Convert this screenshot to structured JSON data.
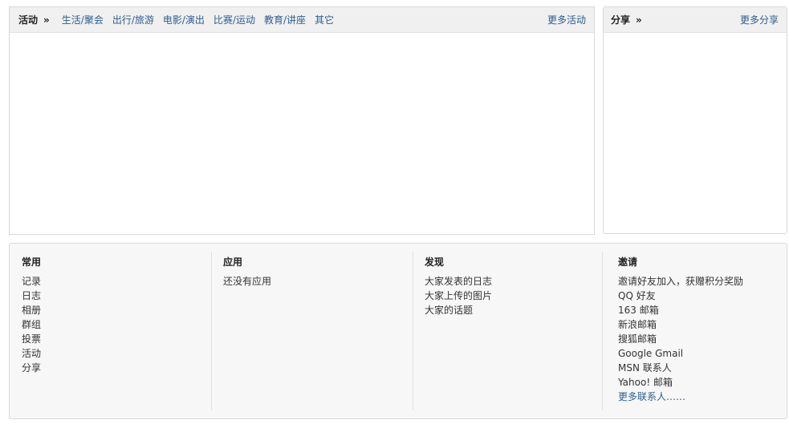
{
  "activity": {
    "title": "活动",
    "arrow": "»",
    "categories": [
      "生活/聚会",
      "出行/旅游",
      "电影/演出",
      "比赛/运动",
      "教育/讲座",
      "其它"
    ],
    "more_label": "更多活动"
  },
  "share": {
    "title": "分享",
    "arrow": "»",
    "more_label": "更多分享"
  },
  "bottom": {
    "common": {
      "heading": "常用",
      "items": [
        "记录",
        "日志",
        "相册",
        "群组",
        "投票",
        "活动",
        "分享"
      ]
    },
    "apps": {
      "heading": "应用",
      "items": [
        "还没有应用"
      ]
    },
    "discover": {
      "heading": "发现",
      "items": [
        "大家发表的日志",
        "大家上传的图片",
        "大家的话题"
      ]
    },
    "invite": {
      "heading": "邀请",
      "items": [
        "邀请好友加入，获赠积分奖励",
        "QQ 好友",
        "163 邮箱",
        "新浪邮箱",
        "搜狐邮箱",
        "Google Gmail",
        "MSN 联系人",
        "Yahoo! 邮箱",
        "更多联系人……"
      ]
    }
  }
}
